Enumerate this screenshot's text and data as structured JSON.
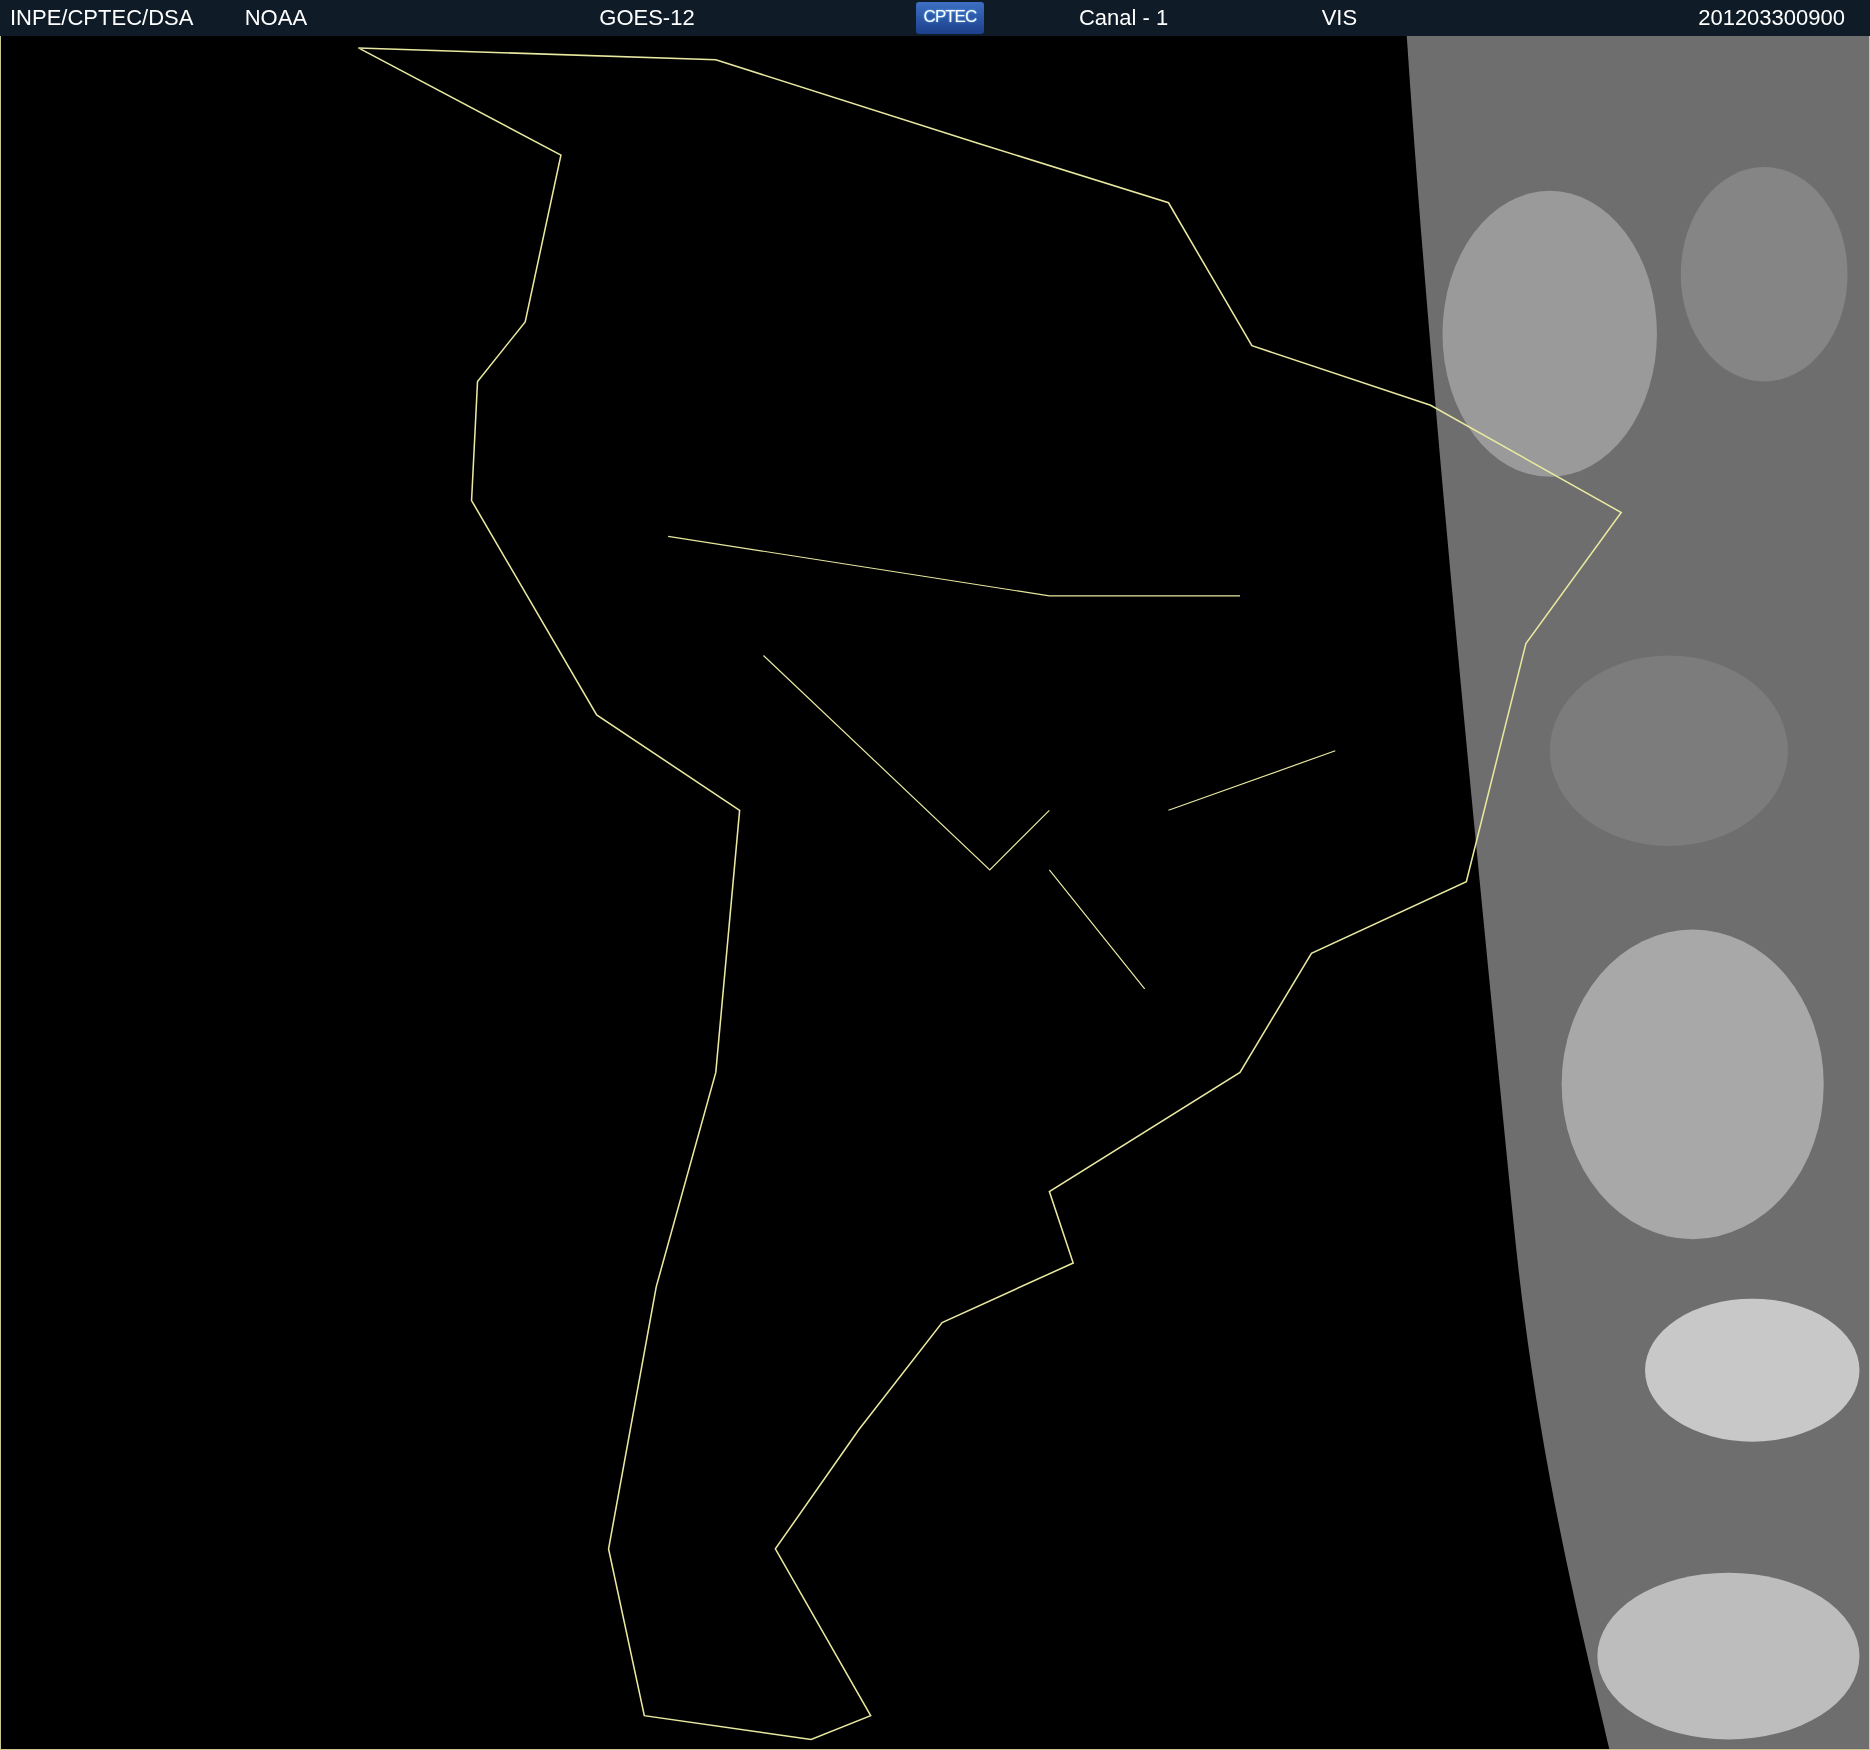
{
  "header": {
    "items": [
      "INPE/CPTEC/DSA",
      "NOAA",
      "GOES-12"
    ],
    "logo": "CPTEC",
    "items_right": [
      "Canal - 1",
      "VIS"
    ],
    "timestamp": "201203300900"
  }
}
